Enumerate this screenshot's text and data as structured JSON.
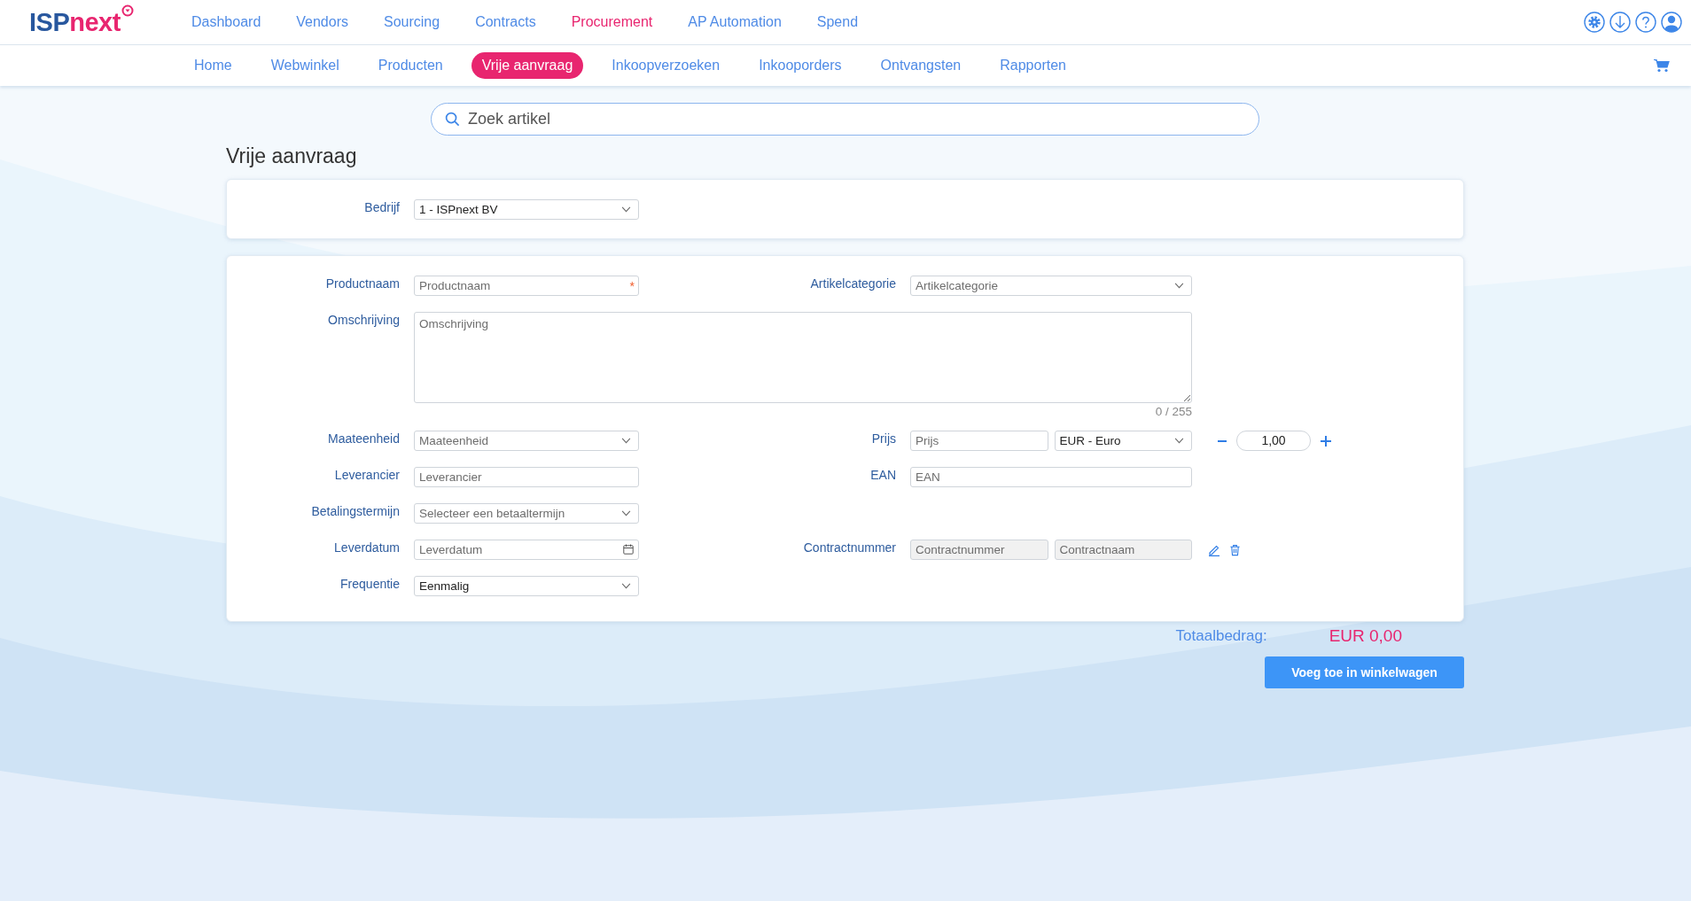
{
  "logo": {
    "part_1": "ISP",
    "part_2": "next"
  },
  "main_nav": [
    {
      "label": "Dashboard",
      "selected": false
    },
    {
      "label": "Vendors",
      "selected": false
    },
    {
      "label": "Sourcing",
      "selected": false
    },
    {
      "label": "Contracts",
      "selected": false
    },
    {
      "label": "Procurement",
      "selected": true
    },
    {
      "label": "AP Automation",
      "selected": false
    },
    {
      "label": "Spend",
      "selected": false
    }
  ],
  "sub_nav": [
    {
      "label": "Home",
      "selected": false
    },
    {
      "label": "Webwinkel",
      "selected": false
    },
    {
      "label": "Producten",
      "selected": false
    },
    {
      "label": "Vrije aanvraag",
      "selected": true
    },
    {
      "label": "Inkoopverzoeken",
      "selected": false
    },
    {
      "label": "Inkooporders",
      "selected": false
    },
    {
      "label": "Ontvangsten",
      "selected": false
    },
    {
      "label": "Rapporten",
      "selected": false
    }
  ],
  "search": {
    "placeholder": "Zoek artikel"
  },
  "page_title": "Vrije aanvraag",
  "company": {
    "label": "Bedrijf",
    "control": {
      "kind": "select",
      "value": "1 - ISPnext BV"
    }
  },
  "rows": [
    {
      "kind": "pair",
      "left": {
        "label": "Productnaam",
        "control": {
          "kind": "text",
          "placeholder": "Productnaam",
          "required_mark": "*"
        }
      },
      "right": {
        "label": "Artikelcategorie",
        "controls": [
          {
            "kind": "select",
            "placeholder": "Artikelcategorie"
          }
        ]
      }
    },
    {
      "kind": "wide",
      "label": "Omschrijving",
      "placeholder": "Omschrijving",
      "counter": "0 / 255"
    },
    {
      "kind": "pair",
      "left": {
        "label": "Maateenheid",
        "control": {
          "kind": "select",
          "placeholder": "Maateenheid"
        }
      },
      "right": {
        "label": "Prijs",
        "controls": [
          {
            "kind": "text",
            "placeholder": "Prijs",
            "disabled": false
          },
          {
            "kind": "select",
            "value": "EUR - Euro"
          }
        ],
        "extra": {
          "kind": "stepper",
          "value": "1,00"
        }
      }
    },
    {
      "kind": "pair",
      "left": {
        "label": "Leverancier",
        "control": {
          "kind": "text",
          "placeholder": "Leverancier"
        }
      },
      "right": {
        "label": "EAN",
        "controls": [
          {
            "kind": "text",
            "placeholder": "EAN",
            "disabled": false
          }
        ]
      }
    },
    {
      "kind": "pair",
      "left": {
        "label": "Betalingstermijn",
        "control": {
          "kind": "select",
          "placeholder": "Selecteer een betaaltermijn"
        }
      }
    },
    {
      "kind": "pair",
      "left": {
        "label": "Leverdatum",
        "control": {
          "kind": "date",
          "placeholder": "Leverdatum"
        }
      },
      "right": {
        "label": "Contractnummer",
        "controls": [
          {
            "kind": "text",
            "placeholder": "Contractnummer",
            "disabled": true
          },
          {
            "kind": "text",
            "placeholder": "Contractnaam",
            "disabled": true
          }
        ],
        "extra": {
          "kind": "actions"
        }
      }
    },
    {
      "kind": "pair",
      "left": {
        "label": "Frequentie",
        "control": {
          "kind": "select",
          "value": "Eenmalig"
        }
      }
    }
  ],
  "total": {
    "label": "Totaalbedrag:",
    "amount": "EUR 0,00"
  },
  "add_button": "Voeg toe in winkelwagen"
}
